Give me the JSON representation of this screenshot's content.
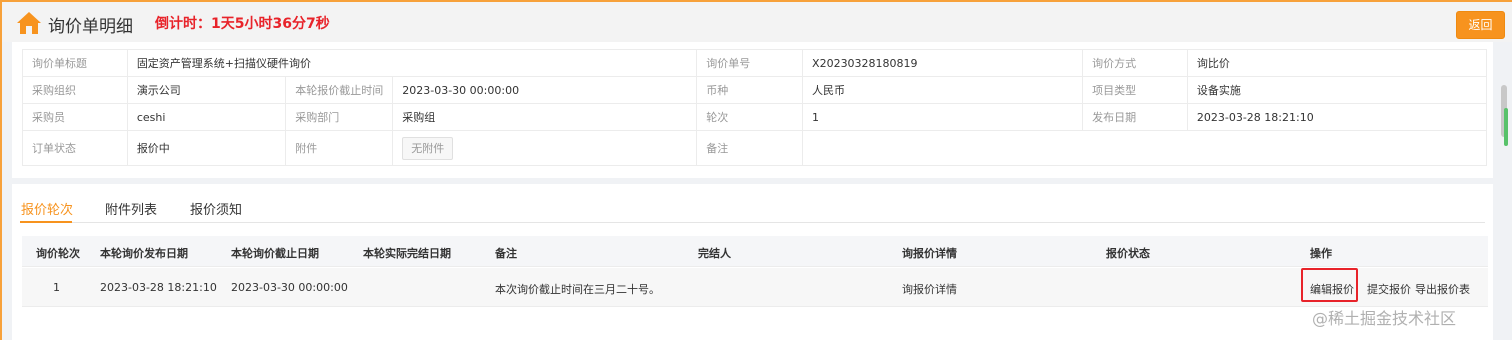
{
  "header": {
    "title": "询价单明细",
    "countdown": "倒计时：1天5小时36分7秒",
    "back_label": "返回",
    "home_icon": "home-icon"
  },
  "info": {
    "row1": {
      "title_label": "询价单标题",
      "title_value": "固定资产管理系统+扫描仪硬件询价",
      "number_label": "询价单号",
      "number_value": "X20230328180819",
      "method_label": "询价方式",
      "method_value": "询比价"
    },
    "row2": {
      "org_label": "采购组织",
      "org_value": "演示公司",
      "deadline_label": "本轮报价截止时间",
      "deadline_value": "2023-03-30 00:00:00",
      "currency_label": "币种",
      "currency_value": "人民币",
      "project_type_label": "项目类型",
      "project_type_value": "设备实施"
    },
    "row3": {
      "buyer_label": "采购员",
      "buyer_value": "ceshi",
      "dept_label": "采购部门",
      "dept_value": "采购组",
      "round_label": "轮次",
      "round_value": "1",
      "publish_label": "发布日期",
      "publish_value": "2023-03-28 18:21:10"
    },
    "row4": {
      "status_label": "订单状态",
      "status_value": "报价中",
      "attachment_label": "附件",
      "attachment_value": "无附件",
      "remark_label": "备注",
      "remark_value": ""
    }
  },
  "tabs": [
    "报价轮次",
    "附件列表",
    "报价须知"
  ],
  "grid": {
    "headers": [
      "询价轮次",
      "本轮询价发布日期",
      "本轮询价截止日期",
      "本轮实际完结日期",
      "备注",
      "完结人",
      "询报价详情",
      "报价状态",
      "操作"
    ],
    "row": {
      "round": "1",
      "publish": "2023-03-28 18:21:10",
      "deadline": "2023-03-30 00:00:00",
      "actual_end": "",
      "remark": "本次询价截止时间在三月二十号。",
      "closer": "",
      "detail_link": "询报价详情",
      "status": "",
      "actions": {
        "edit": "编辑报价",
        "submit": "提交报价",
        "export": "导出报价表"
      }
    }
  },
  "watermark": "@稀土掘金技术社区",
  "colors": {
    "accent": "#f7931e",
    "countdown": "#e8232a",
    "highlight_box": "#e8232a"
  }
}
